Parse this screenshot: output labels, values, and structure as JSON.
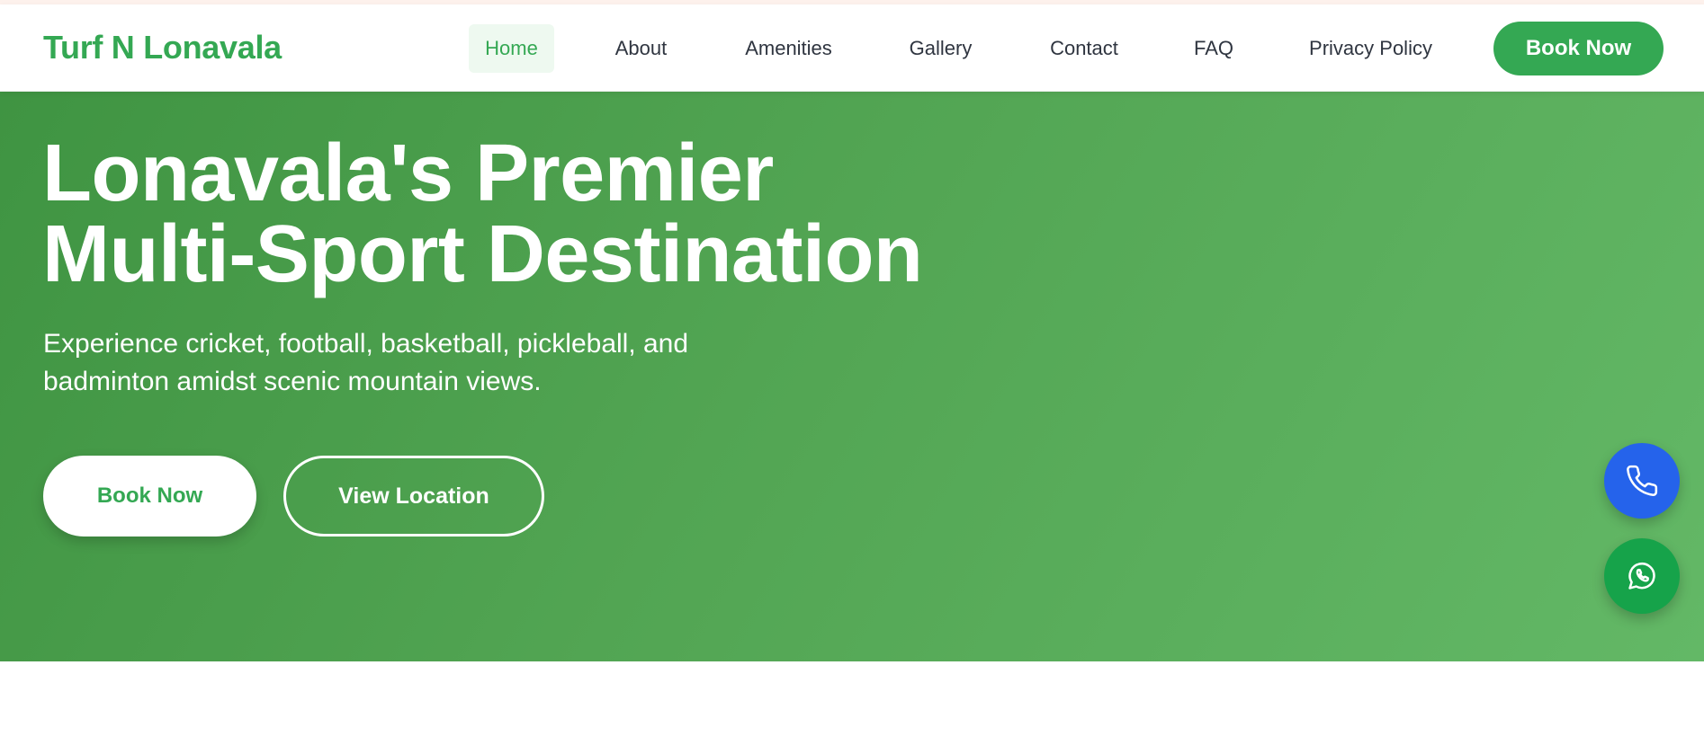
{
  "brand": {
    "name": "Turf N Lonavala",
    "color": "#34a853"
  },
  "nav": {
    "items": [
      {
        "label": "Home",
        "active": true
      },
      {
        "label": "About",
        "active": false
      },
      {
        "label": "Amenities",
        "active": false
      },
      {
        "label": "Gallery",
        "active": false
      },
      {
        "label": "Contact",
        "active": false
      },
      {
        "label": "FAQ",
        "active": false
      },
      {
        "label": "Privacy Policy",
        "active": false
      }
    ],
    "cta_label": "Book Now"
  },
  "hero": {
    "title_line1": "Lonavala's Premier",
    "title_line2": "Multi-Sport Destination",
    "subtitle_line1": "Experience cricket, football, basketball, pickleball, and",
    "subtitle_line2": "badminton amidst scenic mountain views.",
    "primary_button": "Book Now",
    "secondary_button": "View Location",
    "gradient_colors": [
      "#3f9442",
      "#63b866"
    ]
  },
  "floating_actions": [
    {
      "icon": "phone-icon",
      "color": "#2563eb"
    },
    {
      "icon": "whatsapp-icon",
      "color": "#16a34a"
    }
  ]
}
